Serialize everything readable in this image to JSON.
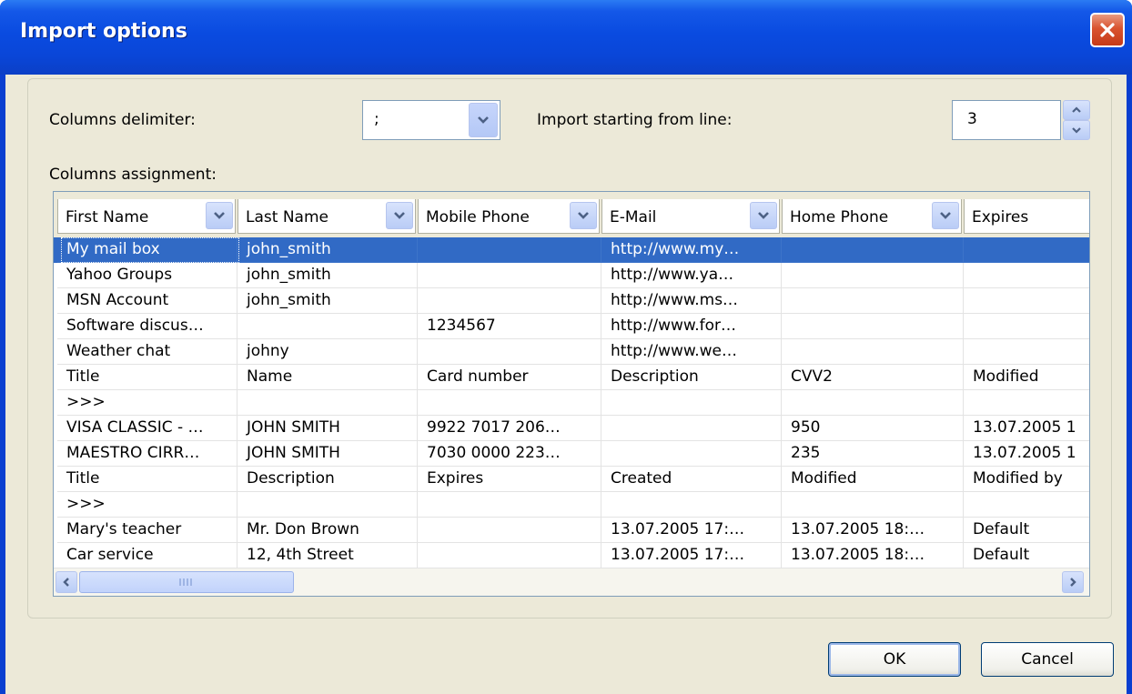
{
  "window": {
    "title": "Import options"
  },
  "colors": {
    "titlebar": "#0a4be0",
    "selection": "#316ac5",
    "close": "#d9532f",
    "dialog_bg": "#ece9d8"
  },
  "form": {
    "delimiter_label": "Columns delimiter:",
    "delimiter_value": ";",
    "start_line_label": "Import starting from line:",
    "start_line_value": "3",
    "assignment_label": "Columns assignment:"
  },
  "grid": {
    "columns": [
      "First Name",
      "Last Name",
      "Mobile Phone",
      "E-Mail",
      "Home Phone",
      "Expires"
    ],
    "rows": [
      [
        "My mail box",
        "john_smith",
        "",
        "http://www.my…",
        "",
        ""
      ],
      [
        "Yahoo Groups",
        "john_smith",
        "",
        "http://www.ya…",
        "",
        ""
      ],
      [
        "MSN Account",
        "john_smith",
        "",
        "http://www.ms…",
        "",
        ""
      ],
      [
        "Software discus…",
        "",
        "1234567",
        "http://www.for…",
        "",
        ""
      ],
      [
        "Weather chat",
        "johny",
        "",
        "http://www.we…",
        "",
        ""
      ],
      [
        "Title",
        "Name",
        "Card number",
        "Description",
        "CVV2",
        "Modified"
      ],
      [
        ">>>",
        "",
        "",
        "",
        "",
        ""
      ],
      [
        "VISA CLASSIC - …",
        "JOHN SMITH",
        "9922 7017 206…",
        "",
        "950",
        "13.07.2005 1"
      ],
      [
        "MAESTRO CIRR…",
        "JOHN SMITH",
        "7030 0000 223…",
        "",
        "235",
        "13.07.2005 1"
      ],
      [
        "Title",
        "Description",
        "Expires",
        "Created",
        "Modified",
        "Modified by"
      ],
      [
        ">>>",
        "",
        "",
        "",
        "",
        ""
      ],
      [
        "Mary's teacher",
        "Mr. Don Brown",
        "",
        "13.07.2005 17:…",
        "13.07.2005 18:…",
        "Default"
      ],
      [
        "Car service",
        "12, 4th Street",
        "",
        "13.07.2005 17:…",
        "13.07.2005 18:…",
        "Default"
      ]
    ],
    "selected_row": 0
  },
  "buttons": {
    "ok": "OK",
    "cancel": "Cancel"
  },
  "icons": {
    "close": "close-icon",
    "combo": "chevron-down-icon",
    "spin_up": "spin-up-icon",
    "spin_down": "spin-down-icon",
    "scroll_left": "scroll-left-icon",
    "scroll_right": "scroll-right-icon"
  }
}
